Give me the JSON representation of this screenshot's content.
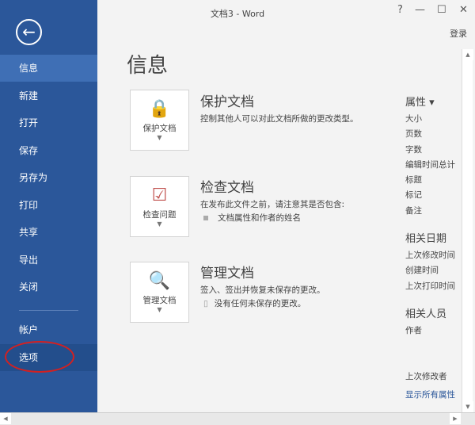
{
  "window": {
    "title": "文档3 - Word",
    "help": "?",
    "minimize": "—",
    "maximize": "☐",
    "close": "✕",
    "login": "登录"
  },
  "sidebar": {
    "back_icon": "←",
    "items": [
      {
        "label": "信息"
      },
      {
        "label": "新建"
      },
      {
        "label": "打开"
      },
      {
        "label": "保存"
      },
      {
        "label": "另存为"
      },
      {
        "label": "打印"
      },
      {
        "label": "共享"
      },
      {
        "label": "导出"
      },
      {
        "label": "关闭"
      },
      {
        "label": "帐户"
      },
      {
        "label": "选项"
      }
    ],
    "selected": "信息",
    "hovered": "选项"
  },
  "main": {
    "title": "信息",
    "sections": [
      {
        "button": "保护文档",
        "icon": "lock-key-icon",
        "title": "保护文档",
        "desc": "控制其他人可以对此文档所做的更改类型。"
      },
      {
        "button": "检查问题",
        "icon": "inspect-document-icon",
        "title": "检查文档",
        "desc": "在发布此文件之前，请注意其是否包含:",
        "bullet": "文档属性和作者的姓名"
      },
      {
        "button": "管理文档",
        "icon": "manage-document-icon",
        "title": "管理文档",
        "desc": "签入、签出并恢复未保存的更改。",
        "bullet": "没有任何未保存的更改。"
      }
    ]
  },
  "properties": {
    "header": "属性 ▾",
    "items": [
      "大小",
      "页数",
      "字数",
      "编辑时间总计",
      "标题",
      "标记",
      "备注"
    ],
    "dates_header": "相关日期",
    "dates": [
      "上次修改时间",
      "创建时间",
      "上次打印时间"
    ],
    "people_header": "相关人员",
    "people": [
      "作者"
    ],
    "last_modified_by": "上次修改者",
    "show_all": "显示所有属性"
  },
  "colors": {
    "sidebar": "#2b579a",
    "annotation": "#d42020"
  }
}
